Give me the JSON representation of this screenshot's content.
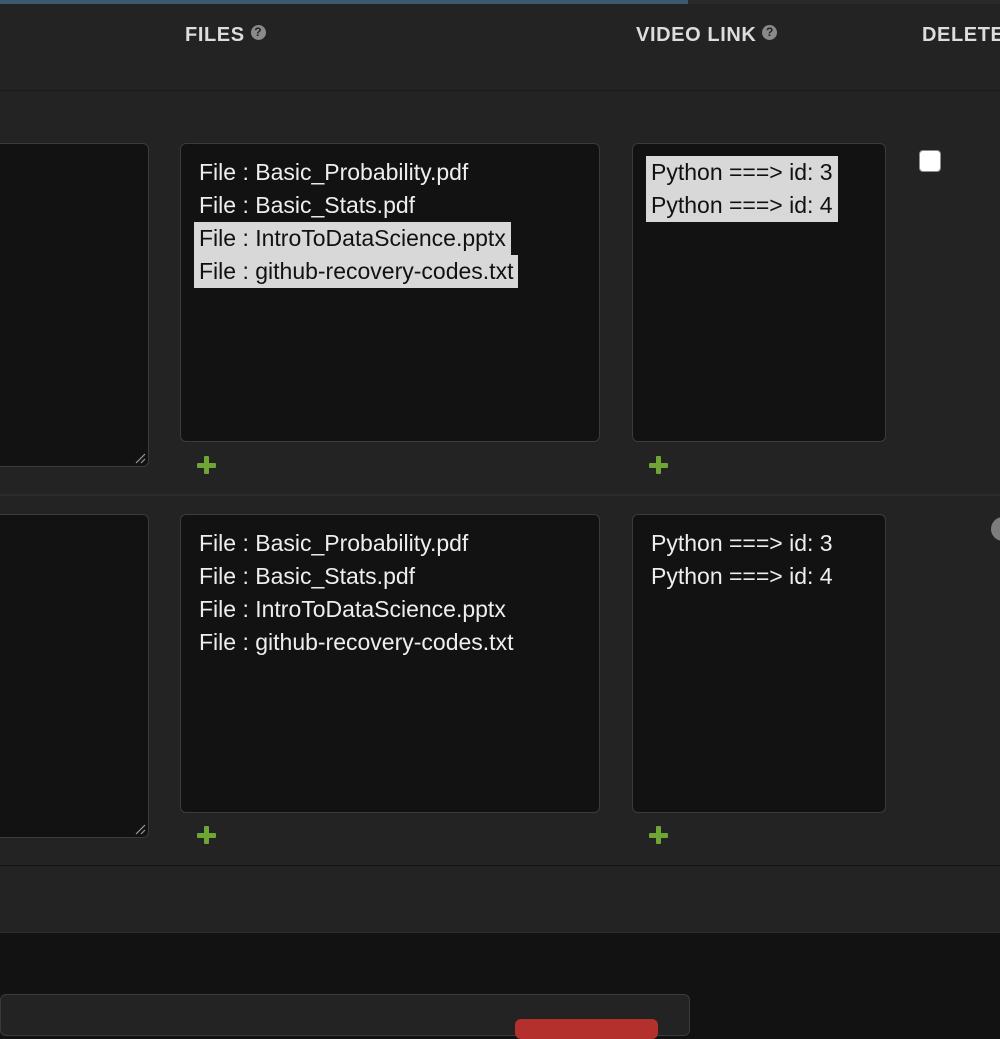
{
  "columns": {
    "files": "FILES",
    "video_link": "VIDEO LINK",
    "delete": "DELETE"
  },
  "rows": [
    {
      "files": [
        {
          "label": "File : Basic_Probability.pdf",
          "selected": false
        },
        {
          "label": "File : Basic_Stats.pdf",
          "selected": false
        },
        {
          "label": "File : IntroToDataScience.pptx",
          "selected": true
        },
        {
          "label": "File : github-recovery-codes.txt",
          "selected": true
        }
      ],
      "videos": [
        {
          "label": "Python ===> id: 3",
          "selected": true
        },
        {
          "label": "Python ===> id: 4",
          "selected": true
        }
      ],
      "delete_checked": false
    },
    {
      "files": [
        {
          "label": "File : Basic_Probability.pdf",
          "selected": false
        },
        {
          "label": "File : Basic_Stats.pdf",
          "selected": false
        },
        {
          "label": "File : IntroToDataScience.pptx",
          "selected": false
        },
        {
          "label": "File : github-recovery-codes.txt",
          "selected": false
        }
      ],
      "videos": [
        {
          "label": "Python ===> id: 3",
          "selected": false
        },
        {
          "label": "Python ===> id: 4",
          "selected": false
        }
      ]
    }
  ],
  "icons": {
    "help": "question-circle-icon",
    "add": "plus-icon",
    "resize": "resize-handle-icon"
  },
  "colors": {
    "accent_add": "#6ea535",
    "selection": "#d8d8d8",
    "danger": "#b3302c"
  }
}
